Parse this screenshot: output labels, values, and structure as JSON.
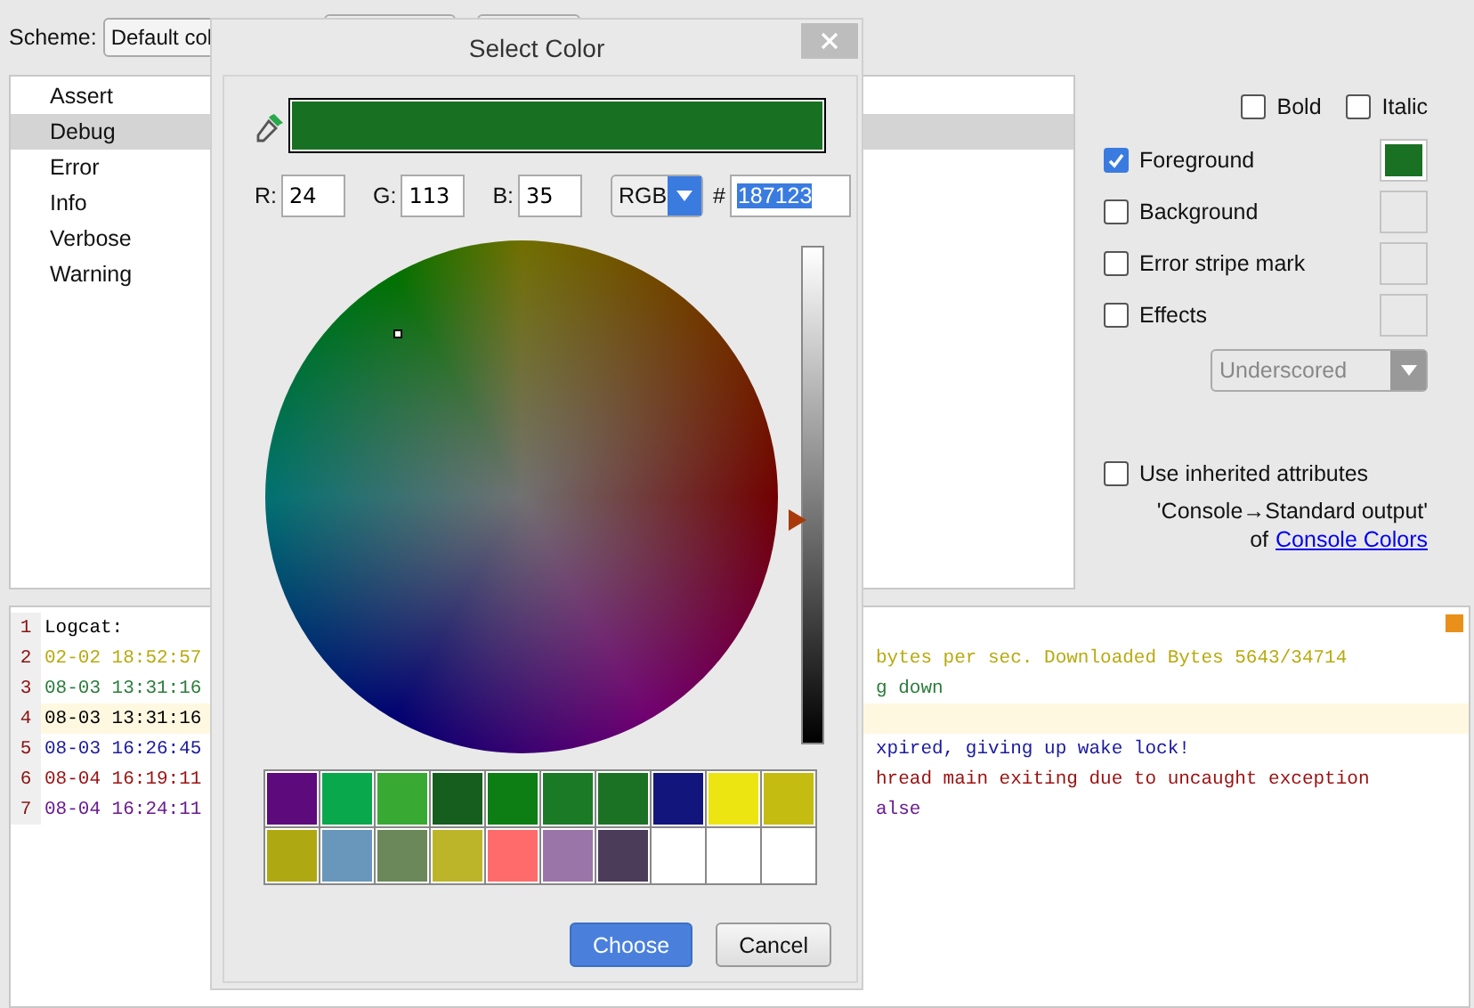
{
  "scheme": {
    "label": "Scheme:",
    "value": "Default col"
  },
  "levels": [
    {
      "label": "Assert",
      "selected": false
    },
    {
      "label": "Debug",
      "selected": true
    },
    {
      "label": "Error",
      "selected": false
    },
    {
      "label": "Info",
      "selected": false
    },
    {
      "label": "Verbose",
      "selected": false
    },
    {
      "label": "Warning",
      "selected": false
    }
  ],
  "font_styles": [
    {
      "label": "Bold",
      "checked": false
    },
    {
      "label": "Italic",
      "checked": false
    }
  ],
  "color_options": [
    {
      "label": "Foreground",
      "checked": true,
      "color": "#1a7023"
    },
    {
      "label": "Background",
      "checked": false
    },
    {
      "label": "Error stripe mark",
      "checked": false
    },
    {
      "label": "Effects",
      "checked": false
    }
  ],
  "effect_type": {
    "value": "Underscored",
    "disabled": true
  },
  "inherit": {
    "label": "Use inherited attributes",
    "checked": false
  },
  "inherit_note": "'Console→Standard output'",
  "inherit_source": {
    "prefix": "of",
    "link": "Console Colors"
  },
  "log": [
    {
      "number": "1",
      "left": "Logcat:",
      "color": "#000000",
      "selected": false
    },
    {
      "number": "2",
      "left": "02-02 18:52:57",
      "right": "bytes per sec. Downloaded Bytes 5643/34714",
      "color": "#b8aa10",
      "selected": false
    },
    {
      "number": "3",
      "left": "08-03 13:31:16",
      "right": "g down",
      "color": "#2a7d3a",
      "selected": false
    },
    {
      "number": "4",
      "left": "08-03 13:31:16",
      "color": "#000000",
      "selected": true
    },
    {
      "number": "5",
      "left": "08-03 16:26:45",
      "right": "xpired, giving up wake lock!",
      "color": "#1a1aa0",
      "selected": false
    },
    {
      "number": "6",
      "left": "08-04 16:19:11",
      "right": "hread main exiting due to uncaught exception",
      "color": "#9a1010",
      "selected": false
    },
    {
      "number": "7",
      "left": "08-04 16:24:11",
      "right": "alse",
      "color": "#6a1a90",
      "selected": false
    }
  ],
  "dialog": {
    "title": "Select Color",
    "color": "#187123",
    "channels": [
      {
        "label": "R:",
        "value": "24"
      },
      {
        "label": "G:",
        "value": "113"
      },
      {
        "label": "B:",
        "value": "35"
      }
    ],
    "mode": "RGB",
    "hash": "#",
    "hex": "187123",
    "brightness": {
      "level": 0.45
    },
    "swatches": [
      {
        "color": "#5c0a7c"
      },
      {
        "color": "#0aa84c"
      },
      {
        "color": "#38aa34"
      },
      {
        "color": "#155e1e"
      },
      {
        "color": "#0d7e14"
      },
      {
        "color": "#1a7a26"
      },
      {
        "color": "#1b7225"
      },
      {
        "color": "#12167c"
      },
      {
        "color": "#ede512"
      },
      {
        "color": "#c4bc10"
      },
      {
        "color": "#aea912"
      },
      {
        "color": "#6996bb"
      },
      {
        "color": "#6a8859"
      },
      {
        "color": "#bcb52a"
      },
      {
        "color": "#ff6b6b"
      },
      {
        "color": "#9a75a8"
      },
      {
        "color": "#4b3d5a"
      },
      {
        "color": "#ffffff"
      },
      {
        "color": "#ffffff"
      },
      {
        "color": "#ffffff"
      }
    ],
    "buttons": [
      {
        "label": "Choose",
        "kind": "primary"
      },
      {
        "label": "Cancel",
        "kind": "secondary"
      }
    ]
  }
}
